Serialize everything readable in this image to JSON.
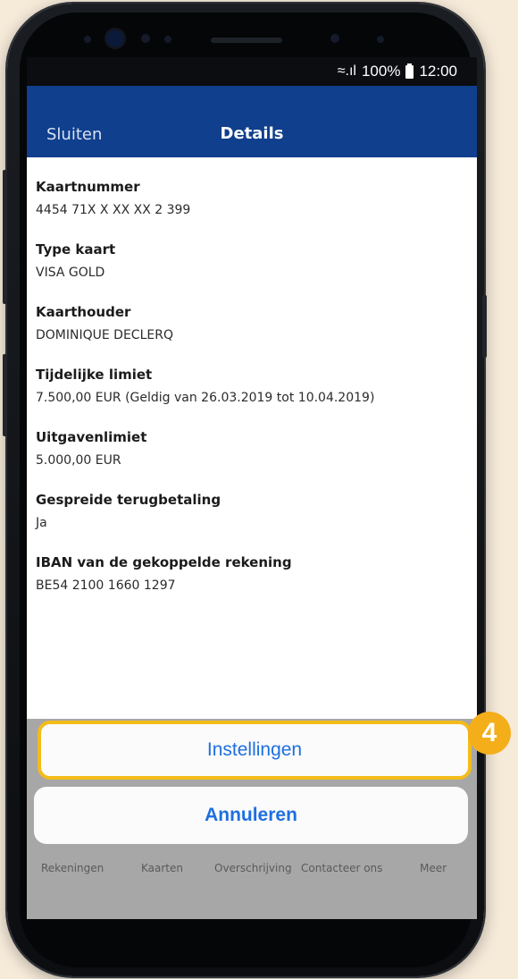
{
  "status_bar": {
    "signal_icon": "wifi-signal-icon",
    "battery_percent": "100%",
    "time": "12:00"
  },
  "nav": {
    "close_label": "Sluiten",
    "title": "Details"
  },
  "details": [
    {
      "label": "Kaartnummer",
      "value": "4454  71X X XX XX 2 399"
    },
    {
      "label": "Type kaart",
      "value": "VISA GOLD"
    },
    {
      "label": "Kaarthouder",
      "value": "DOMINIQUE DECLERQ"
    },
    {
      "label": "Tijdelijke limiet",
      "value": "7.500,00 EUR (Geldig van 26.03.2019 tot 10.04.2019)"
    },
    {
      "label": "Uitgavenlimiet",
      "value": "5.000,00 EUR"
    },
    {
      "label": "Gespreide terugbetaling",
      "value": "Ja"
    },
    {
      "label": "IBAN van de gekoppelde rekening",
      "value": "BE54 2100 1660 1297"
    }
  ],
  "action_sheet": {
    "settings_label": "Instellingen",
    "cancel_label": "Annuleren"
  },
  "tab_bar": {
    "items": [
      "Rekeningen",
      "Kaarten",
      "Overschrijving",
      "Contacteer ons",
      "Meer"
    ]
  },
  "marker": {
    "number": "4"
  },
  "colors": {
    "nav_blue": "#0f3f8d",
    "action_blue": "#1e6fe0",
    "highlight_yellow": "#f3bc19",
    "marker_orange": "#f3ae1a",
    "page_background": "#f6ead9"
  }
}
